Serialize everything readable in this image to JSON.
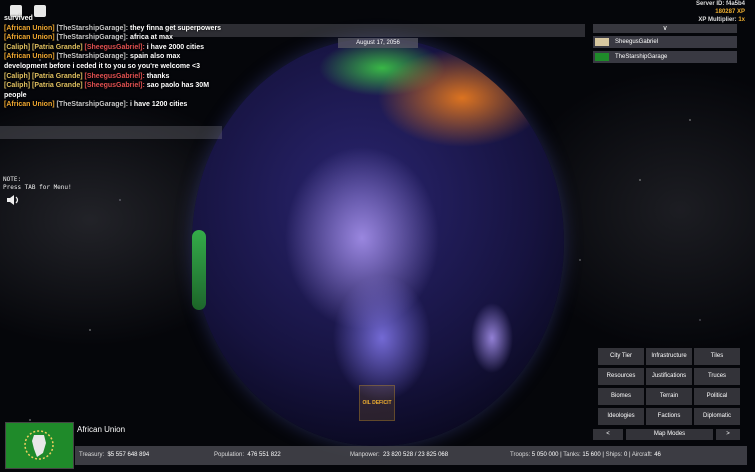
{
  "server": {
    "id": "Server ID: f4a5b4",
    "xp": "180287 XP",
    "multiplier_label": "XP Multiplier:",
    "multiplier_value": "1x"
  },
  "chat": {
    "messages": [
      {
        "tag": "",
        "name": "",
        "text": "survived"
      },
      {
        "tag": "[African Union]",
        "name": "[TheStarshipGarage]:",
        "text": "they finna get superpowers"
      },
      {
        "tag": "[African Union]",
        "name": "[TheStarshipGarage]:",
        "text": "africa at max"
      },
      {
        "tag": "[Caliph] [Patria Grande]",
        "name": "[SheegusGabriel]:",
        "text": "i have 2000 cities"
      },
      {
        "tag": "[African Union]",
        "name": "[TheStarshipGarage]:",
        "text": "spain also max development before i ceded it to you so you're welcome <3"
      },
      {
        "tag": "[Caliph] [Patria Grande]",
        "name": "[SheegusGabriel]:",
        "text": "thanks"
      },
      {
        "tag": "[Caliph] [Patria Grande]",
        "name": "[SheegusGabriel]:",
        "text": "sao paolo has 30M people"
      },
      {
        "tag": "[African Union]",
        "name": "[TheStarshipGarage]:",
        "text": "i have 1200 cities"
      }
    ]
  },
  "date": "August 17, 2056",
  "note": {
    "line1": "NOTE:",
    "line2": "Press TAB for Menu!"
  },
  "players": {
    "header": "∨",
    "list": [
      {
        "name": "SheegusGabriel",
        "flag_color": "#d8c8a0"
      },
      {
        "name": "TheStarshipGarage",
        "flag_color": "#1f8a2a"
      }
    ]
  },
  "menu": {
    "buttons": [
      "City Tier",
      "Infrastructure",
      "Tiles",
      "Resources",
      "Justifications",
      "Truces",
      "Biomes",
      "Terrain",
      "Political",
      "Ideologies",
      "Factions",
      "Diplomatic"
    ],
    "prev": "<",
    "map_modes": "Map Modes",
    "next": ">"
  },
  "alert": "OIL DEFICIT",
  "country": {
    "name": "African Union",
    "treasury_label": "Treasury:",
    "treasury": "$5 557 648 894",
    "population_label": "Population:",
    "population": "476 551 822",
    "manpower_label": "Manpower:",
    "manpower": "23 820 528  /  23 825 068",
    "troops_label": "Troops:",
    "troops": "5 050 000",
    "tanks_label": "Tanks:",
    "tanks": "15 600",
    "ships_label": "Ships:",
    "ships": "0",
    "aircraft_label": "Aircraft:",
    "aircraft": "46"
  },
  "colors": {
    "accent_gold": "#f0a830",
    "enemy_red": "#e05050",
    "au_green": "#1f8a2a"
  }
}
